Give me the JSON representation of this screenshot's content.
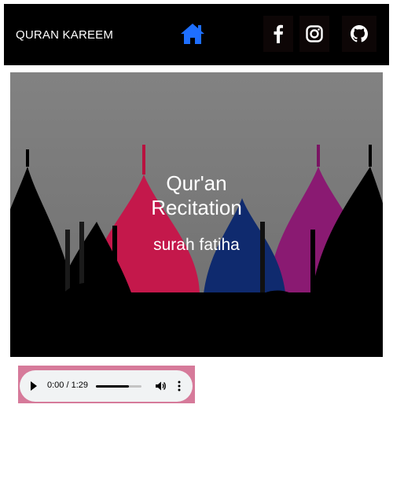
{
  "navbar": {
    "brand": "QURAN KAREEM",
    "icons": [
      "home-icon",
      "facebook-icon",
      "instagram-icon",
      "github-icon"
    ],
    "home_color": "#1e6fff"
  },
  "hero": {
    "title_line1": "Qur'an",
    "title_line2": "Recitation",
    "subtitle": "surah fatiha"
  },
  "audio": {
    "time": "0:00 / 1:29",
    "volume_level": 0.72,
    "frame_color": "#d67a9a"
  }
}
